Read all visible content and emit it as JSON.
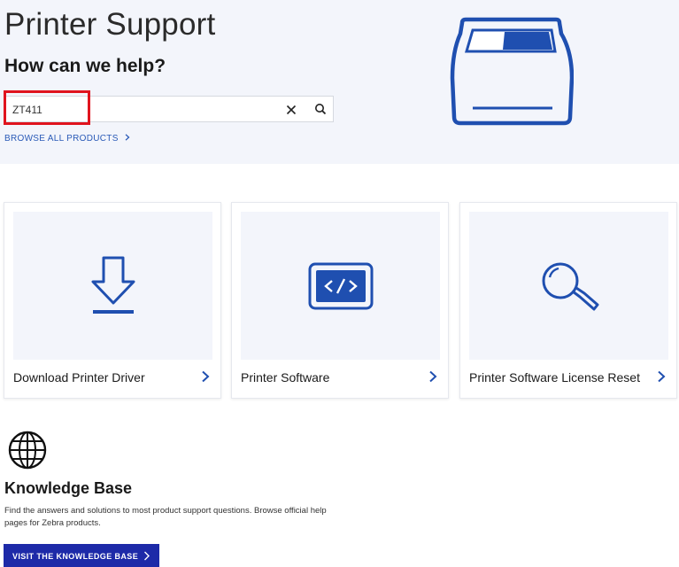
{
  "hero": {
    "title": "Printer Support",
    "subtitle": "How can we help?",
    "search": {
      "value": "ZT411",
      "placeholder": ""
    },
    "browse_label": "BROWSE ALL PRODUCTS"
  },
  "cards": [
    {
      "label": "Download Printer Driver",
      "icon": "download-icon"
    },
    {
      "label": "Printer Software",
      "icon": "code-icon"
    },
    {
      "label": "Printer Software License Reset",
      "icon": "magnifier-icon"
    }
  ],
  "knowledge_base": {
    "title": "Knowledge Base",
    "description": "Find the answers and solutions to most product support questions. Browse official help pages for Zebra products.",
    "button_label": "VISIT THE KNOWLEDGE BASE"
  },
  "colors": {
    "brand_blue": "#1f4fb0",
    "hero_bg": "#f3f5fb",
    "highlight_red": "#e0141e",
    "button_bg": "#1d2aa8"
  }
}
